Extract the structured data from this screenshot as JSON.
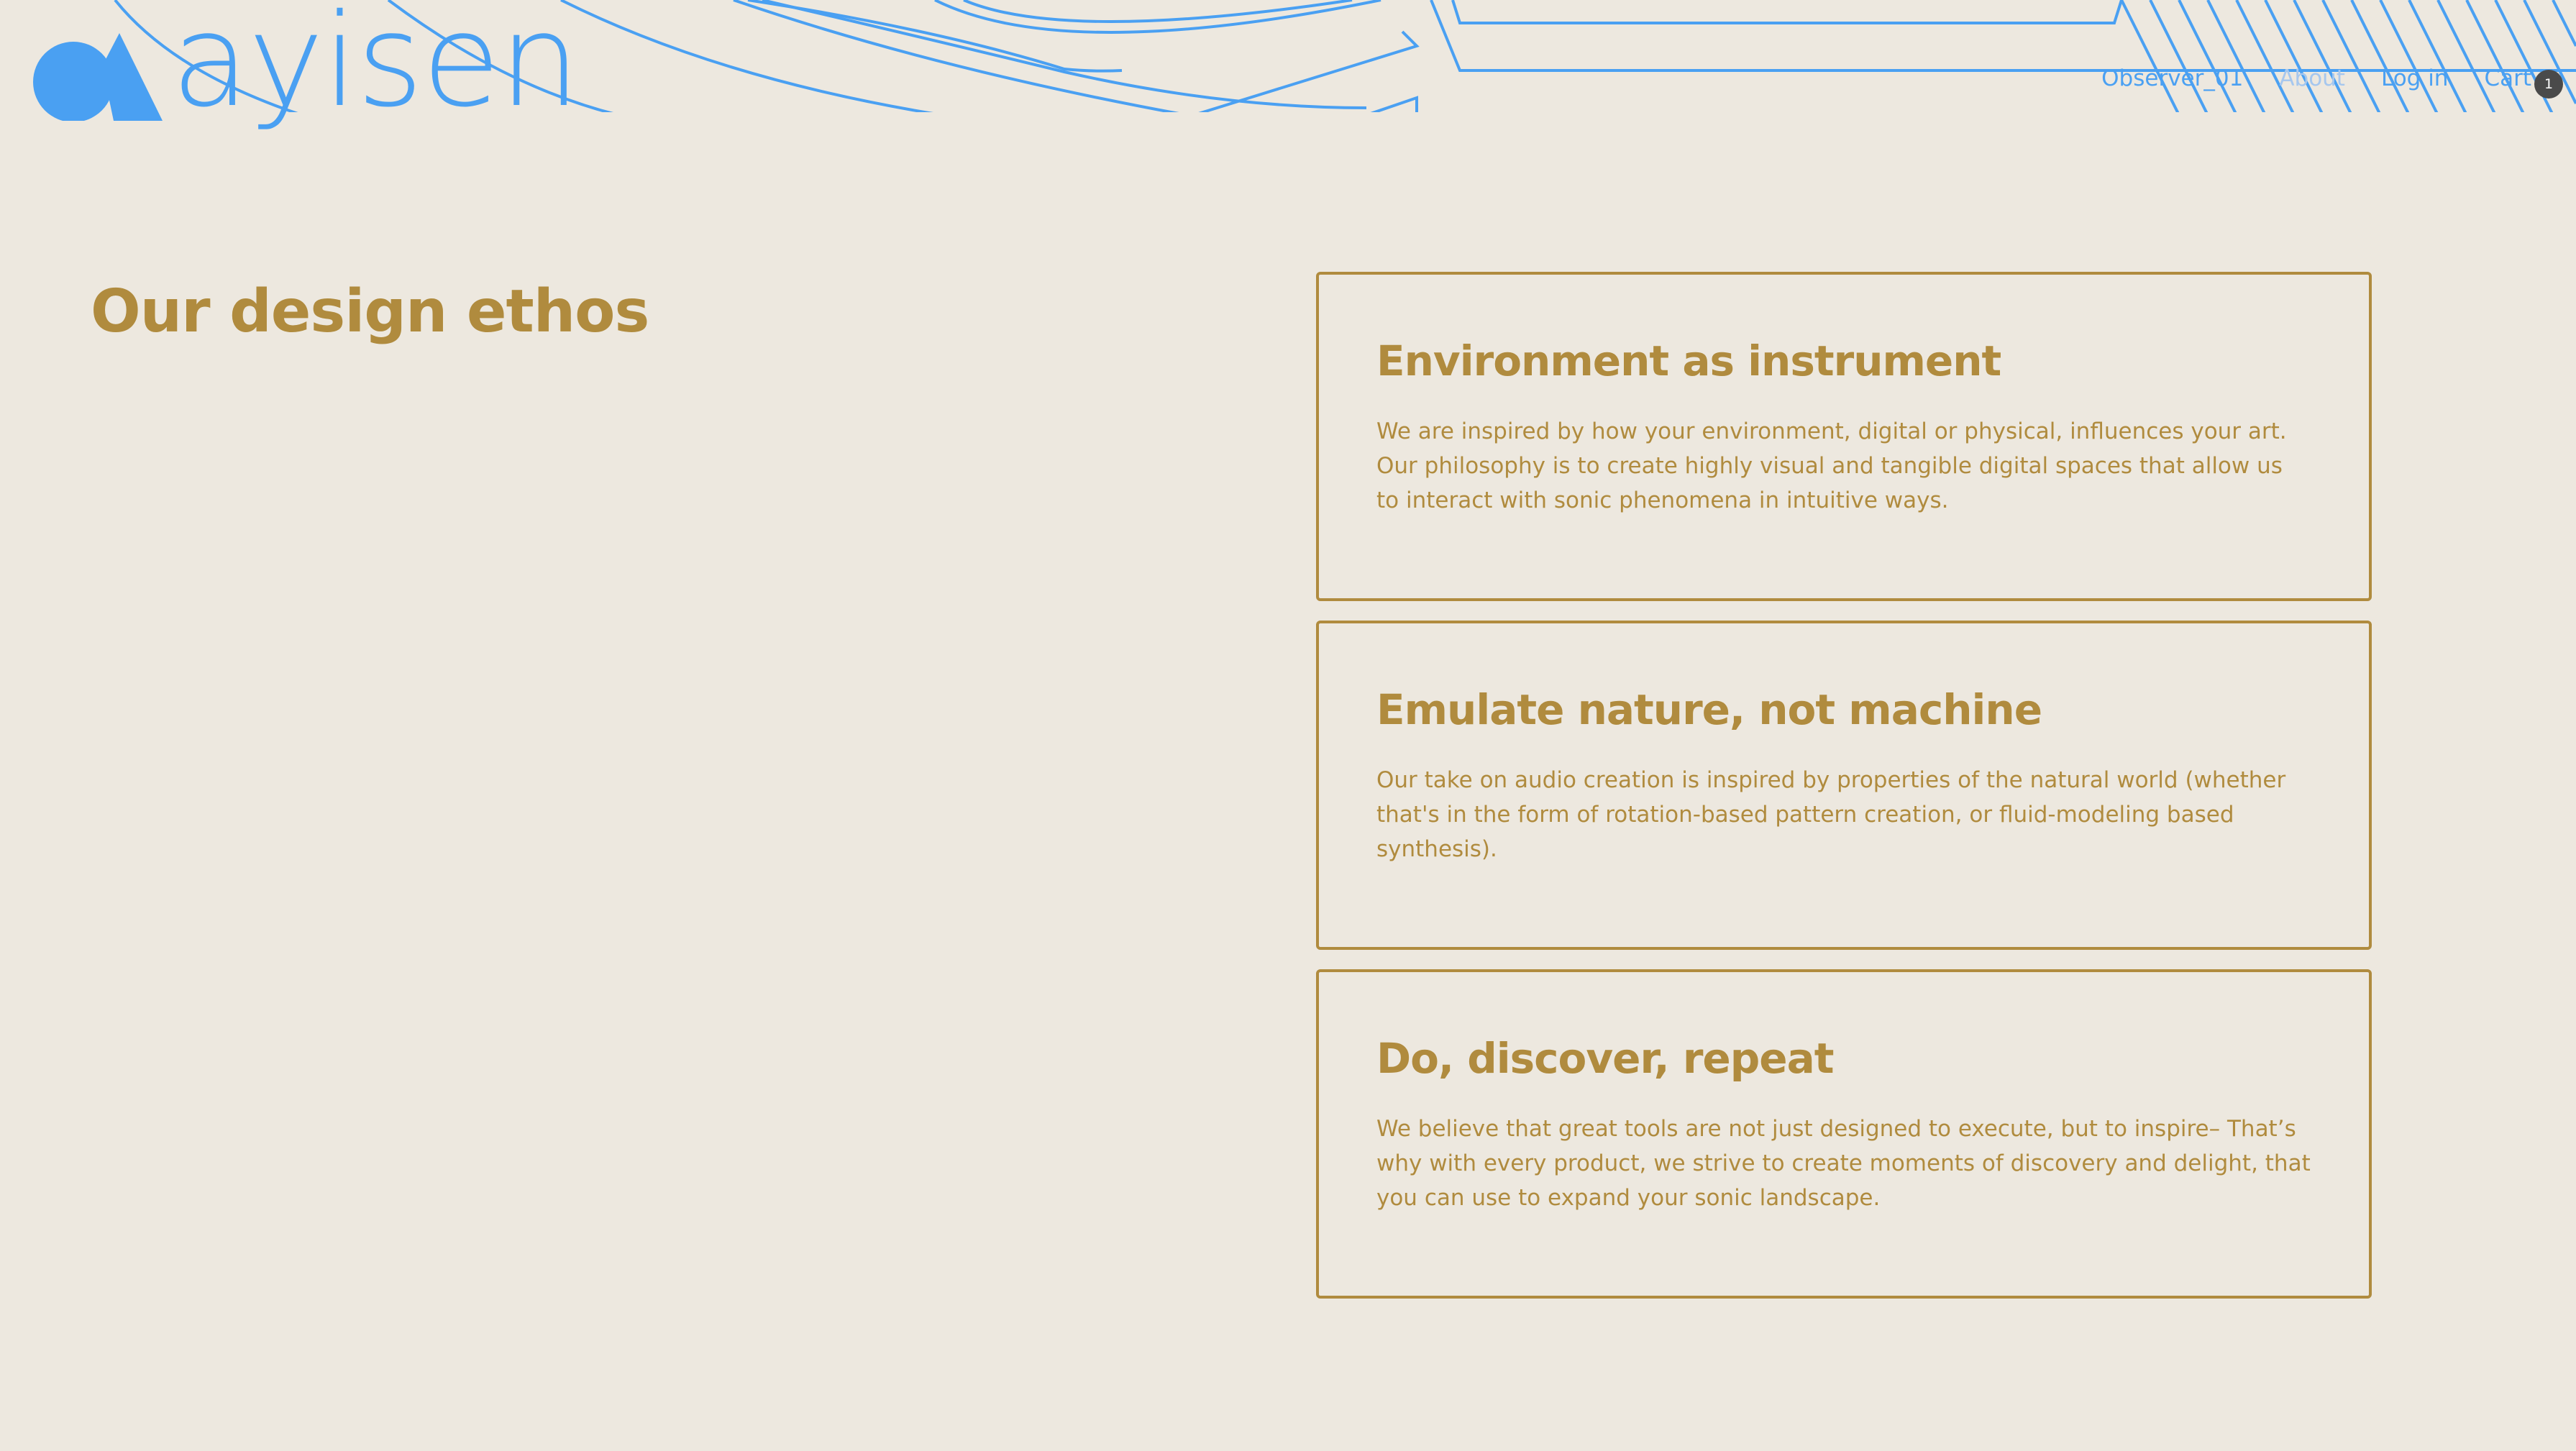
{
  "brand": {
    "name": "ayisen",
    "accent_color": "#4aa0f2",
    "gold_color": "#b08b3e",
    "background_color": "#ede8df"
  },
  "nav": {
    "items": [
      {
        "label": "Observer_01",
        "icon": ""
      },
      {
        "label": "About",
        "icon": ""
      },
      {
        "label": "Log in",
        "icon": ""
      }
    ],
    "cart": {
      "label": "Cart",
      "count": "1"
    }
  },
  "main": {
    "title": "Our design ethos",
    "cards": [
      {
        "heading": "Environment as instrument",
        "body": "We are inspired by how your environment, digital or physical, influences your art. Our philosophy is to create highly visual and tangible digital spaces that allow us to interact with sonic phenomena in intuitive ways."
      },
      {
        "heading": "Emulate nature, not machine",
        "body": "Our take on audio creation is inspired by properties of the natural world (whether that's in the form of rotation-based pattern creation, or fluid-modeling based synthesis)."
      },
      {
        "heading": "Do, discover, repeat",
        "body": "We believe that great tools are not just designed to execute, but to inspire– That’s why with every product, we strive to create moments of discovery and delight, that you can use to expand your sonic landscape."
      }
    ]
  }
}
